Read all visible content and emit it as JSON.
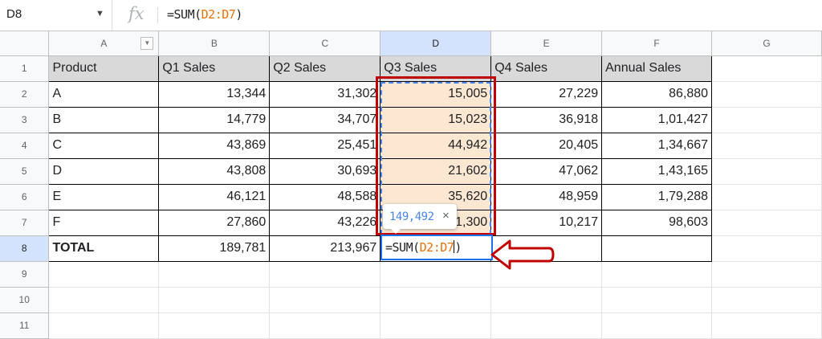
{
  "name_box": {
    "value": "D8"
  },
  "formula_bar": {
    "fx_label": "fx",
    "prefix": "=SUM(",
    "ref": "D2:D7",
    "suffix": ")"
  },
  "columns": [
    "A",
    "B",
    "C",
    "D",
    "E",
    "F",
    "G"
  ],
  "selected_column": "D",
  "rows": [
    "1",
    "2",
    "3",
    "4",
    "5",
    "6",
    "7",
    "8",
    "9",
    "10",
    "11"
  ],
  "selected_row": "8",
  "sheet": {
    "headers": [
      "Product",
      "Q1 Sales",
      "Q2 Sales",
      "Q3 Sales",
      "Q4 Sales",
      "Annual Sales"
    ],
    "data": [
      [
        "A",
        "13,344",
        "31,302",
        "15,005",
        "27,229",
        "86,880"
      ],
      [
        "B",
        "14,779",
        "34,707",
        "15,023",
        "36,918",
        "1,01,427"
      ],
      [
        "C",
        "43,869",
        "25,451",
        "44,942",
        "20,405",
        "1,34,667"
      ],
      [
        "D",
        "43,808",
        "30,693",
        "21,602",
        "47,062",
        "1,43,165"
      ],
      [
        "E",
        "46,121",
        "48,588",
        "35,620",
        "48,959",
        "1,79,288"
      ],
      [
        "F",
        "27,860",
        "43,226",
        "11,300",
        "10,217",
        "98,603"
      ]
    ],
    "total": [
      "TOTAL",
      "189,781",
      "213,967",
      "",
      "",
      ""
    ]
  },
  "active_cell": {
    "prefix": "=SUM(",
    "ref": "D2:D7",
    "suffix": ")"
  },
  "tooltip": {
    "value": "149,492",
    "close_icon": "×"
  },
  "colors": {
    "highlight_fill": "#fce8d2",
    "annotation_red": "#c00000",
    "selection_blue": "#1a73e8",
    "range_ref": "#e8710a"
  }
}
